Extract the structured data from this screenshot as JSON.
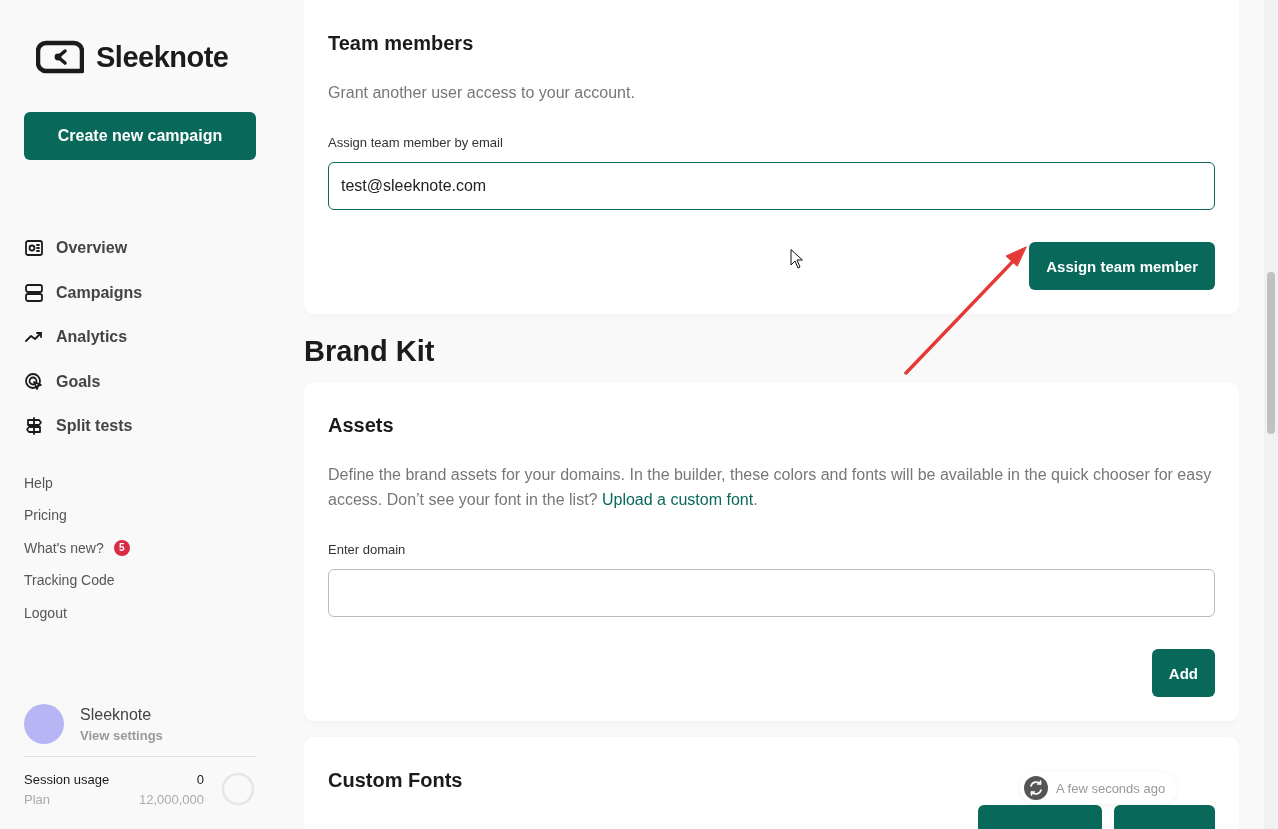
{
  "sidebar": {
    "logo": "Sleeknote",
    "create_button": "Create new campaign",
    "nav": [
      {
        "label": "Overview",
        "kind": "overview"
      },
      {
        "label": "Campaigns",
        "kind": "campaigns"
      },
      {
        "label": "Analytics",
        "kind": "analytics"
      },
      {
        "label": "Goals",
        "kind": "goals"
      },
      {
        "label": "Split tests",
        "kind": "split"
      }
    ],
    "links": [
      {
        "label": "Help"
      },
      {
        "label": "Pricing"
      },
      {
        "label": "What's new?",
        "badge": "5"
      },
      {
        "label": "Tracking Code"
      },
      {
        "label": "Logout"
      }
    ],
    "account": {
      "name": "Sleeknote",
      "subtitle": "View settings"
    },
    "usage": {
      "label": "Session usage",
      "value": "0",
      "plan_label": "Plan",
      "plan_value": "12,000,000"
    }
  },
  "team_card": {
    "title": "Team members",
    "description": "Grant another user access to your account.",
    "field_label": "Assign team member by email",
    "value": "test@sleeknote.com",
    "button": "Assign team member"
  },
  "brand_kit": {
    "heading": "Brand Kit",
    "assets_card": {
      "title": "Assets",
      "description": "Define the brand assets for your domains. In the builder, these colors and fonts will be available in the quick chooser for easy access. Don’t see your font in the list?",
      "link": "Upload a custom font",
      "link_suffix": ".",
      "field_label": "Enter domain",
      "button": "Add"
    },
    "fonts_card": {
      "title": "Custom Fonts"
    }
  },
  "toast": {
    "text": "A few seconds ago"
  }
}
